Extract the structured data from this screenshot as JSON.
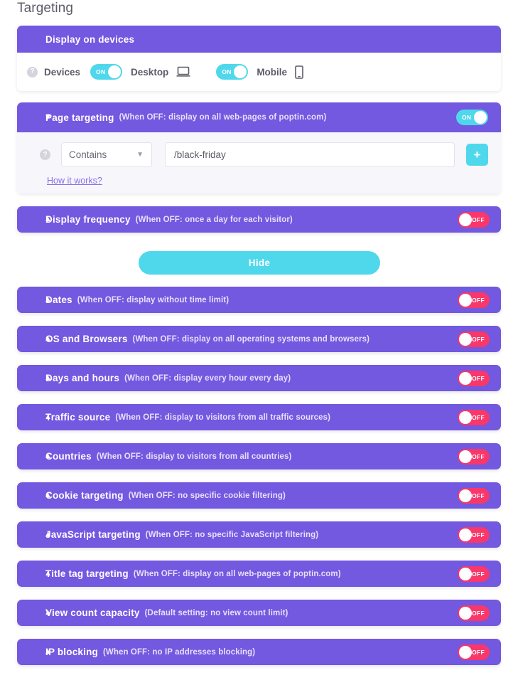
{
  "page": {
    "title": "Targeting"
  },
  "devices_card": {
    "header": "Display on devices",
    "help_icon": "help-circle-icon",
    "label": "Devices",
    "desktop": {
      "label": "Desktop",
      "toggle_state": "ON",
      "icon": "desktop-monitor-icon"
    },
    "mobile": {
      "label": "Mobile",
      "toggle_state": "ON",
      "icon": "mobile-phone-icon"
    }
  },
  "page_targeting": {
    "title": "Page targeting",
    "subtitle": "(When OFF: display on all web-pages of poptin.com)",
    "toggle_state": "ON",
    "chevron": "chevron-down-icon",
    "help_icon": "help-circle-icon",
    "condition_value": "Contains",
    "condition_caret": "chevron-down-icon",
    "url_value": "/black-friday",
    "url_placeholder": "/black-friday",
    "add_label": "+",
    "how_it_works": "How it works?"
  },
  "display_frequency": {
    "title": "Display frequency",
    "subtitle": "(When OFF: once a day for each visitor)",
    "toggle_state": "OFF",
    "chevron": "chevron-up-icon"
  },
  "hide_button": {
    "label": "Hide"
  },
  "sections": [
    {
      "title": "Dates",
      "subtitle": "(When OFF: display without time limit)",
      "toggle_state": "OFF",
      "chevron": "chevron-up-icon"
    },
    {
      "title": "OS and Browsers",
      "subtitle": "(When OFF: display on all operating systems and browsers)",
      "toggle_state": "OFF",
      "chevron": "chevron-up-icon"
    },
    {
      "title": "Days and hours",
      "subtitle": "(When OFF: display every hour every day)",
      "toggle_state": "OFF",
      "chevron": "chevron-up-icon"
    },
    {
      "title": "Traffic source",
      "subtitle": "(When OFF: display to visitors from all traffic sources)",
      "toggle_state": "OFF",
      "chevron": "chevron-up-icon"
    },
    {
      "title": "Countries",
      "subtitle": "(When OFF: display to visitors from all countries)",
      "toggle_state": "OFF",
      "chevron": "chevron-up-icon"
    },
    {
      "title": "Cookie targeting",
      "subtitle": "(When OFF: no specific cookie filtering)",
      "toggle_state": "OFF",
      "chevron": "chevron-up-icon"
    },
    {
      "title": "JavaScript targeting",
      "subtitle": "(When OFF: no specific JavaScript filtering)",
      "toggle_state": "OFF",
      "chevron": "chevron-up-icon"
    },
    {
      "title": "Title tag targeting",
      "subtitle": "(When OFF: display on all web-pages of poptin.com)",
      "toggle_state": "OFF",
      "chevron": "chevron-up-icon"
    },
    {
      "title": "View count capacity",
      "subtitle": "(Default setting: no view count limit)",
      "toggle_state": "OFF",
      "chevron": "chevron-up-icon"
    },
    {
      "title": "IP blocking",
      "subtitle": "(When OFF: no IP addresses blocking)",
      "toggle_state": "OFF",
      "chevron": "chevron-up-icon"
    }
  ],
  "colors": {
    "purple": "#7358e0",
    "cyan": "#4fd8ec",
    "pink": "#f8376a",
    "body_bg": "#f6f6fb",
    "text_gray": "#5c5c68"
  }
}
